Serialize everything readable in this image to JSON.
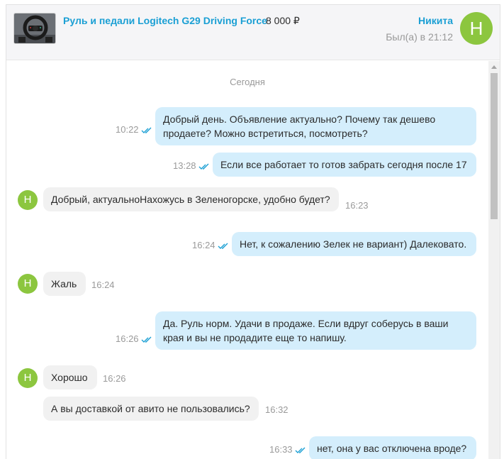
{
  "header": {
    "ad_title": "Руль и педали Logitech G29 Driving Force",
    "ad_price": "8 000 ₽",
    "user_name": "Никита",
    "user_status": "Был(а) в 21:12",
    "avatar_letter": "Н",
    "thumbnail_icon": "steering-wheel-photo"
  },
  "chat": {
    "date_separator": "Сегодня",
    "messages": [
      {
        "direction": "out",
        "text": "Добрый день. Объявление актуально? Почему так дешево продаете? Можно встретиться, посмотреть?",
        "time": "10:22",
        "read": true
      },
      {
        "direction": "out",
        "text": "Если все работает то готов забрать сегодня после 17",
        "time": "13:28",
        "read": true
      },
      {
        "direction": "in",
        "text": "Добрый, актуальноНахожусь в Зеленогорске, удобно будет?",
        "time": "16:23",
        "avatar": "Н"
      },
      {
        "direction": "out",
        "text": "Нет, к сожалению Зелек не вариант) Далековато.",
        "time": "16:24",
        "read": true
      },
      {
        "direction": "in",
        "text": "Жаль",
        "time": "16:24",
        "avatar": "Н"
      },
      {
        "direction": "out",
        "text": "Да. Руль норм. Удачи в продаже. Если вдруг соберусь в ваши края и вы не продадите еще то напишу.",
        "time": "16:26",
        "read": true
      },
      {
        "direction": "in",
        "text": "Хорошо",
        "time": "16:26",
        "avatar": "Н"
      },
      {
        "direction": "in",
        "text": "А вы доставкой от авито не пользовались?",
        "time": "16:32"
      },
      {
        "direction": "out",
        "text": "нет, она у вас отключена вроде?",
        "time": "16:33",
        "read": true
      }
    ]
  },
  "colors": {
    "accent": "#1a9fd4",
    "outgoing_bubble": "#d4eefc",
    "incoming_bubble": "#f1f1f1",
    "avatar": "#8cc63f",
    "read_check": "#1a9fd4"
  }
}
